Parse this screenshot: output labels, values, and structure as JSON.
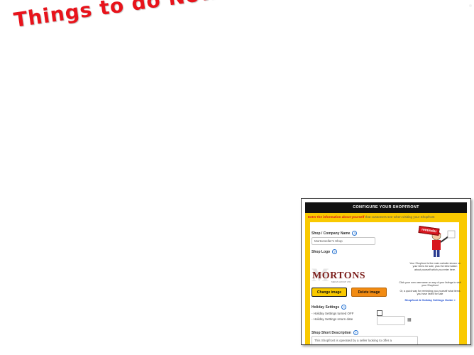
{
  "headline": "Things to do Now!",
  "screenshot": {
    "header_title": "CONFIGURE YOUR SHOPFRONT",
    "subtitle_red": "Enter the information about yourself",
    "subtitle_grey": "that customers see when visiting your Shopfront",
    "company_label": "Shop / Company Name",
    "company_value": "Mortonseller's Shop",
    "logo_label": "Shop Logo",
    "logo_name": "MORTONS",
    "logo_tagline": "MEDIA GROUP LTD",
    "change_image": "Change image",
    "delete_image": "Delete image",
    "holiday_label": "Holiday Settings",
    "holiday_off": "- Holiday Settings turned OFF",
    "holiday_return": "- Holiday Settings return date",
    "description_label": "Shop Short Description",
    "description_value": "This Shopfront is operated by a seller looking to offer a",
    "reminder_badge": "reminder",
    "reminder_text_1": "Your Shopfront is the main website shown on your items for sale, plus the information about yourself which you enter here.",
    "reminder_text_2": "Click your own username on any of your listings to visit your Shopfront",
    "reminder_text_3": "Or, a quick way for reminding you yourself what items you have listed for sale",
    "guide_link": "Shopfront & Holiday Settings Guide »"
  },
  "colors": {
    "headline": "#e8131b",
    "frame_yellow": "#f9c900",
    "delete_orange": "#f28b12"
  }
}
